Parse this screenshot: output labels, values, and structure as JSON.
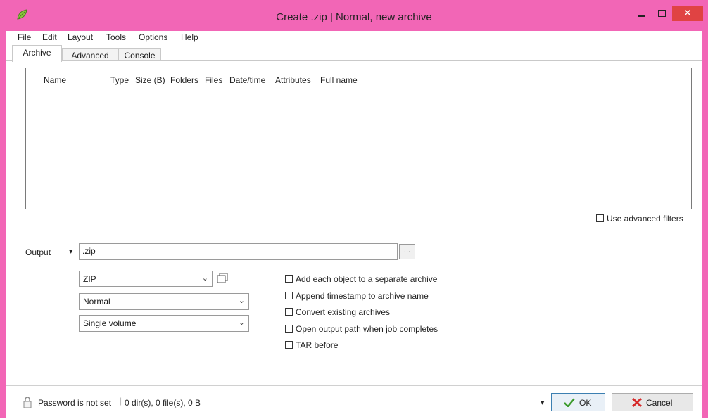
{
  "window": {
    "title": "Create .zip | Normal, new archive",
    "close_glyph": "✕"
  },
  "menu": [
    "File",
    "Edit",
    "Layout",
    "Tools",
    "Options",
    "Help"
  ],
  "tabs": [
    "Archive",
    "Advanced",
    "Console"
  ],
  "columns": [
    "Name",
    "Type",
    "Size (B)",
    "Folders",
    "Files",
    "Date/time",
    "Attributes",
    "Full name"
  ],
  "filters": {
    "advanced_label": "Use advanced filters"
  },
  "output": {
    "label": "Output",
    "dropdown_glyph": "▾",
    "path_value": ".zip",
    "browse_label": "..."
  },
  "format": {
    "selected": "ZIP",
    "options_icon": "clipboard-icon"
  },
  "compression": {
    "selected": "Normal"
  },
  "split": {
    "selected": "Single volume"
  },
  "options": [
    "Add each object to a separate archive",
    "Append timestamp to archive name",
    "Convert existing archives",
    "Open output path when job completes",
    "TAR before"
  ],
  "status": {
    "password": "Password is not set",
    "summary": "0 dir(s), 0 file(s), 0 B"
  },
  "buttons": {
    "more_glyph": "▾",
    "ok": "OK",
    "cancel": "Cancel"
  },
  "colors": {
    "title_bar": "#f266b6",
    "close_button": "#e04343",
    "ok_icon": "#3a9a2a",
    "cancel_icon": "#d62b2b"
  }
}
